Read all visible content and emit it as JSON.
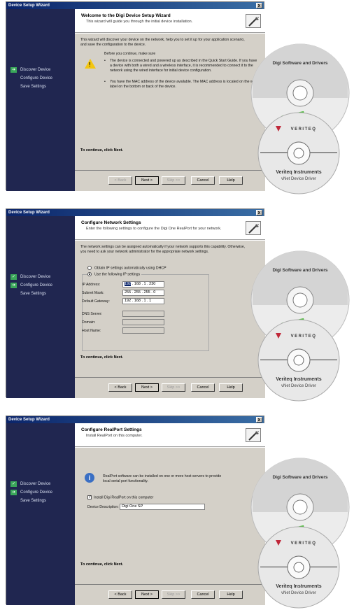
{
  "panels": [
    {
      "window_title": "Device Setup Wizard",
      "close": "x",
      "header_title": "Welcome to the Digi Device Setup Wizard",
      "header_subtitle": "This wizard will guide you through the initial device installation.",
      "steps": [
        "Discover Device",
        "Configure Device",
        "Save Settings"
      ],
      "active_step": 0,
      "intro": "This wizard will discover your device on the network, help you to set it up for your application scenario, and save the configuration to the device.",
      "before": "Before you continue, make sure",
      "bullet_1": "The device is connected and powered up as described in the Quick Start Guide. If you have a device with both a wired and a wireless interface, it is recommended to connect it to the network using the wired interface for initial device configuration.",
      "bullet_2": "You have the MAC address of the device available. The MAC address is located on the white label on the bottom or back of the device.",
      "continue_text": "To continue, click Next."
    },
    {
      "window_title": "Device Setup Wizard",
      "close": "x",
      "header_title": "Configure Network Settings",
      "header_subtitle": "Enter the following settings to configure the Digi One RealPort for your network.",
      "steps": [
        "Discover Device",
        "Configure Device",
        "Save Settings"
      ],
      "active_step": 1,
      "intro": "The network settings can be assigned automatically if your network supports this capability. Otherwise, you need to ask your network administrator for the appropriate network settings.",
      "radio_dhcp": "Obtain IP settings automatically using DHCP",
      "radio_static": "Use the following IP settings",
      "ip_label": "IP Address:",
      "ip_first": "192",
      "ip_rest": " . 168 . 1 . 230",
      "mask_label": "Subnet Mask:",
      "mask_value": "255 . 255 . 255 . 0",
      "gateway_label": "Default Gateway:",
      "gateway_value": "192 . 168 . 1 . 1",
      "dns_label": "DNS Server:",
      "domain_label": "Domain:",
      "host_label": "Host Name:",
      "continue_text": "To continue, click Next."
    },
    {
      "window_title": "Device Setup Wizard",
      "close": "x",
      "header_title": "Configure RealPort Settings",
      "header_subtitle": "Install RealPort on this computer.",
      "steps": [
        "Discover Device",
        "Configure Device",
        "Save Settings"
      ],
      "active_step": 1,
      "info_text": "RealPort software can be installed on one or more host servers to provide local serial port functionality.",
      "install_label": "Install Digi RealPort on this computer",
      "install_checked": "✓",
      "desc_label": "Device Description:",
      "desc_value": "Digi One SP",
      "continue_text": "To continue, click Next."
    }
  ],
  "buttons": {
    "back": "< Back",
    "next": "Next >",
    "skip": "Skip >>",
    "cancel": "Cancel",
    "help": "Help"
  },
  "disc_software": {
    "label": "Digi Software and Drivers",
    "logo": "Digi"
  },
  "disc_driver": {
    "brand": "VERITEQ",
    "title": "Veriteq Instruments",
    "subtitle": "vNet Device Driver"
  },
  "colors": {
    "sidebar": "#202650",
    "titlebar": "#0a246a",
    "dialog": "#d4d0c8",
    "step_marker": "#3aa75a",
    "digi_green": "#4dbb3a",
    "veriteq_red": "#c0283a"
  }
}
